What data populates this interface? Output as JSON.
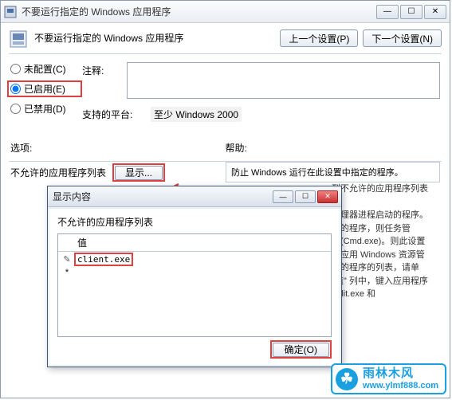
{
  "window": {
    "title": "不要运行指定的 Windows 应用程序"
  },
  "header": {
    "title": "不要运行指定的 Windows 应用程序",
    "prev": "上一个设置(P)",
    "next": "下一个设置(N)"
  },
  "radios": {
    "not_configured": "未配置(C)",
    "enabled": "已启用(E)",
    "disabled": "已禁用(D)"
  },
  "comment_label": "注释:",
  "platform_label": "支持的平台:",
  "platform_value": "至少 Windows 2000",
  "options_label": "选项:",
  "help_label": "帮助:",
  "disallowed_label": "不允许的应用程序列表",
  "show_button": "显示...",
  "help_panel_line": "防止 Windows 运行在此设置中指定的程序。",
  "side_text": {
    "l1": "到不允许的应用程序列表",
    "l2": "管理器进程启动的程序。",
    "l3": "定的程序，则任务管",
    "l4": "符(Cmd.exe)。则此设置",
    "l5": "的应用 Windows 资源管",
    "l6": "动的程序的列表，请单",
    "l7": "\"值\" 列中，键入应用程序",
    "l8": "ledit.exe 和"
  },
  "dialog": {
    "title": "显示内容",
    "list_label": "不允许的应用程序列表",
    "col_header": "值",
    "row_value": "client.exe",
    "ok": "确定(O)"
  },
  "watermark": {
    "cn": "雨林木风",
    "url": "www.ylmf888.com"
  }
}
